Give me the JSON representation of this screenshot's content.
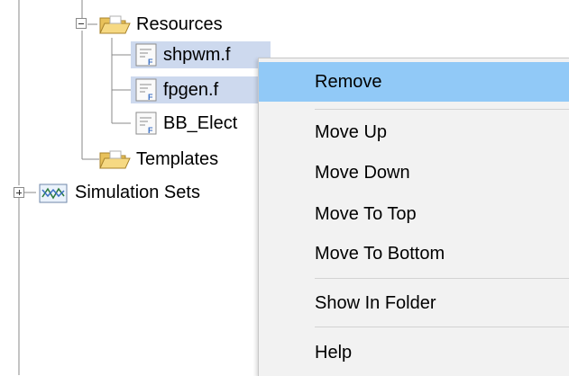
{
  "tree": {
    "items": [
      {
        "label": "Resources",
        "icon": "folder-open-icon",
        "expander": "minus"
      },
      {
        "label": "shpwm.f",
        "icon": "file-f-icon",
        "selected": true
      },
      {
        "label": "fpgen.f",
        "icon": "file-f-icon",
        "selected": true
      },
      {
        "label": "BB_Elect",
        "icon": "file-f-icon",
        "selected": false
      },
      {
        "label": "Templates",
        "icon": "folder-open-icon"
      },
      {
        "label": "Simulation Sets",
        "icon": "waveform-icon",
        "expander": "plus"
      }
    ]
  },
  "context_menu": {
    "items": [
      {
        "label": "Remove",
        "highlighted": true
      },
      {
        "label": "Move Up"
      },
      {
        "label": "Move Down"
      },
      {
        "label": "Move To Top"
      },
      {
        "label": "Move To Bottom"
      },
      {
        "label": "Show In Folder"
      },
      {
        "label": "Help"
      }
    ]
  },
  "colors": {
    "selection": "#cdd9ee",
    "menu_highlight": "#91c9f7",
    "menu_background": "#f2f2f2"
  }
}
